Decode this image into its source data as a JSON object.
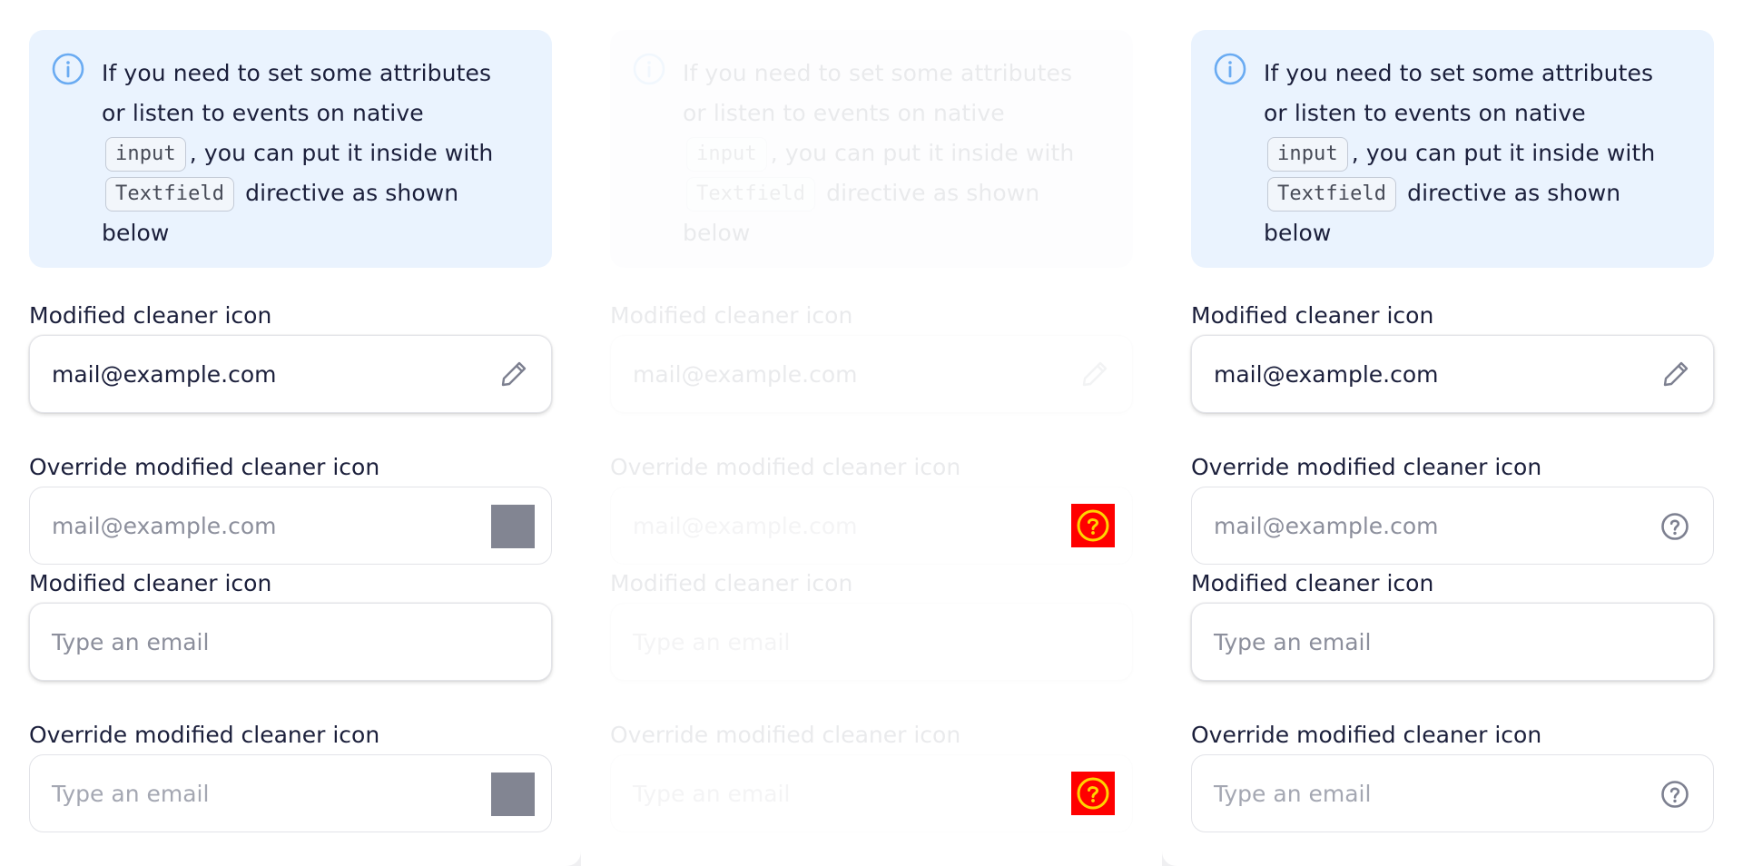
{
  "notice": {
    "text_1": "If you need to set some attributes or listen to events on native",
    "code_1": "input",
    "text_2": ", you can put it inside with",
    "code_2": "Textfield",
    "text_3": "directive as shown below"
  },
  "examples": {
    "modified_label": "Modified cleaner icon",
    "override_label": "Override modified cleaner icon",
    "email_value": "mail@example.com",
    "email_placeholder": "mail@example.com",
    "empty_placeholder": "Type an email"
  },
  "colors": {
    "notice_bg": "#eaf3fe",
    "info_icon": "#6aabf2",
    "grey_block": "#828592",
    "red_block": "#ff0000",
    "yellow_icon": "#ffd400"
  },
  "icons": {
    "info": "info-circle-icon",
    "cleaner": "pencil-icon",
    "override": "question-circle-icon"
  }
}
